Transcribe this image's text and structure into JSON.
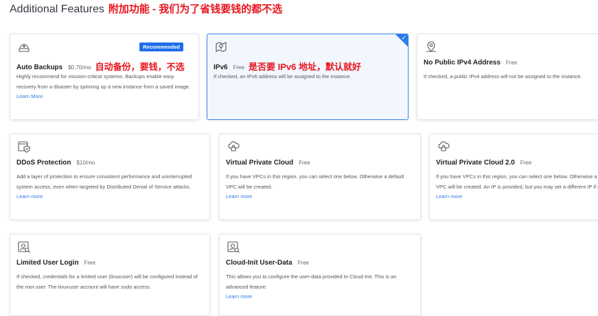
{
  "section": {
    "title": "Additional Features",
    "annotation": "附加功能 - 我们为了省钱要钱的都不选"
  },
  "colors": {
    "accent": "#1d6fe8",
    "link": "#2f7ae5",
    "annotation": "#e8161e",
    "selected_bg": "#f2f7fe",
    "selected_border": "#3d83f0"
  },
  "cards": [
    {
      "icon": "backup-icon",
      "title": "Auto Backups",
      "price": "$0.70/mo",
      "annotation": "自动备份，要钱，不选",
      "badge": "Recommended",
      "description": "Highly recommend for mission-critical systems. Backups enable easy recovery from a disaster by spinning up a new instance from a saved image.",
      "link": "Learn More"
    },
    {
      "icon": "map-pin-icon",
      "title": "IPv6",
      "price": "Free",
      "annotation": "是否要 IPv6 地址，默认就好",
      "selected": true,
      "checkmark": "✓",
      "description": "If checked, an IPv6 address will be assigned to the instance."
    },
    {
      "icon": "map-pin-off-icon",
      "title": "No Public IPv4 Address",
      "price": "Free",
      "description": "If checked, a public IPv4 address will not be assigned to the instance."
    },
    {
      "icon": "ddos-shield-icon",
      "title": "DDoS Protection",
      "price": "$10/mo",
      "description": "Add a layer of protection to ensure consistent performance and uninterrupted system access, even when targeted by Distributed Denial of Service attacks.",
      "link": "Learn more"
    },
    {
      "icon": "cloud-lock-icon",
      "title": "Virtual Private Cloud",
      "price": "Free",
      "description": "If you have VPCs in this region, you can select one below. Otherwise a default VPC will be created.",
      "link": "Learn more"
    },
    {
      "icon": "cloud-lock-icon",
      "title": "Virtual Private Cloud 2.0",
      "price": "Free",
      "description": "If you have VPCs in this region, you can select one below. Otherwise a default VPC will be created. An IP is provided, but you may set a different IP if desired.",
      "link": "Learn more"
    },
    {
      "icon": "user-search-icon",
      "title": "Limited User Login",
      "price": "Free",
      "description": "If checked, credentials for a limited user (linuxuser) will be configured instead of the root user. The linuxuser account will have sudo access."
    },
    {
      "icon": "user-search-icon",
      "title": "Cloud-Init User-Data",
      "price": "Free",
      "description": "This allows you to configure the user-data provided to Cloud-Init. This is an advanced feature.",
      "link": "Learn more"
    }
  ]
}
